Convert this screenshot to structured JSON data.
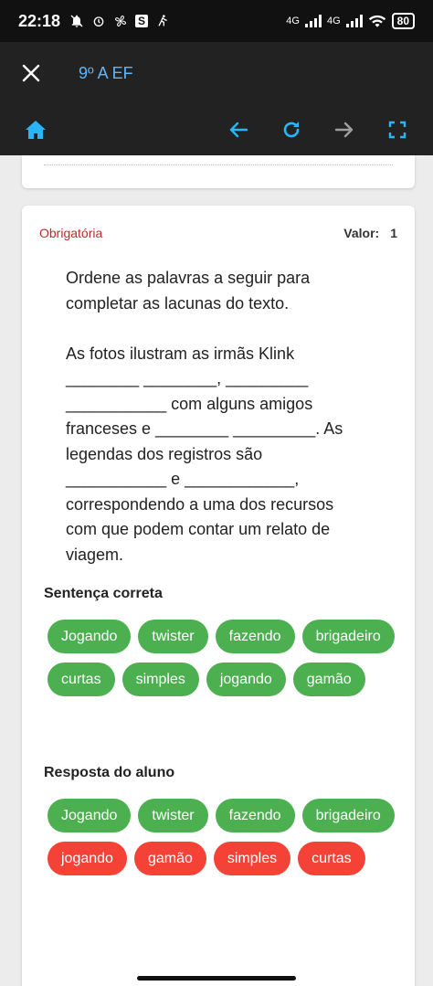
{
  "status_bar": {
    "time": "22:18",
    "network_1": "4G",
    "network_2": "4G",
    "battery": "80"
  },
  "header": {
    "title": "9º A EF"
  },
  "toolbar": {
    "icons": [
      "home-icon",
      "arrow-left-icon",
      "refresh-icon",
      "arrow-right-icon",
      "fullscreen-icon"
    ],
    "accent_color": "#29b6f6"
  },
  "card": {
    "mandatory_label": "Obrigatória",
    "value_label": "Valor:",
    "value": "1",
    "question_p1": "Ordene as palavras a seguir para completar as lacunas do texto.",
    "question_p2": "As fotos ilustram as irmãs Klink ________ ________, _________ ___________ com alguns amigos franceses e ________ _________. As legendas dos registros são ___________ e ____________, correspondendo a uma dos recursos com que podem contar um relato de viagem."
  },
  "correct_section": {
    "label": "Sentença correta",
    "chips": [
      {
        "text": "Jogando",
        "status": "correct"
      },
      {
        "text": "twister",
        "status": "correct"
      },
      {
        "text": "fazendo",
        "status": "correct"
      },
      {
        "text": "brigadeiro",
        "status": "correct"
      },
      {
        "text": "curtas",
        "status": "correct"
      },
      {
        "text": "simples",
        "status": "correct"
      },
      {
        "text": "jogando",
        "status": "correct"
      },
      {
        "text": "gamão",
        "status": "correct"
      }
    ]
  },
  "student_section": {
    "label": "Resposta do aluno",
    "chips": [
      {
        "text": "Jogando",
        "status": "correct"
      },
      {
        "text": "twister",
        "status": "correct"
      },
      {
        "text": "fazendo",
        "status": "correct"
      },
      {
        "text": "brigadeiro",
        "status": "correct"
      },
      {
        "text": "jogando",
        "status": "wrong"
      },
      {
        "text": "gamão",
        "status": "wrong"
      },
      {
        "text": "simples",
        "status": "wrong"
      },
      {
        "text": "curtas",
        "status": "wrong"
      }
    ]
  },
  "colors": {
    "correct": "#4caf50",
    "wrong": "#f44336",
    "mandatory": "#c62828",
    "title": "#64b5f6"
  }
}
